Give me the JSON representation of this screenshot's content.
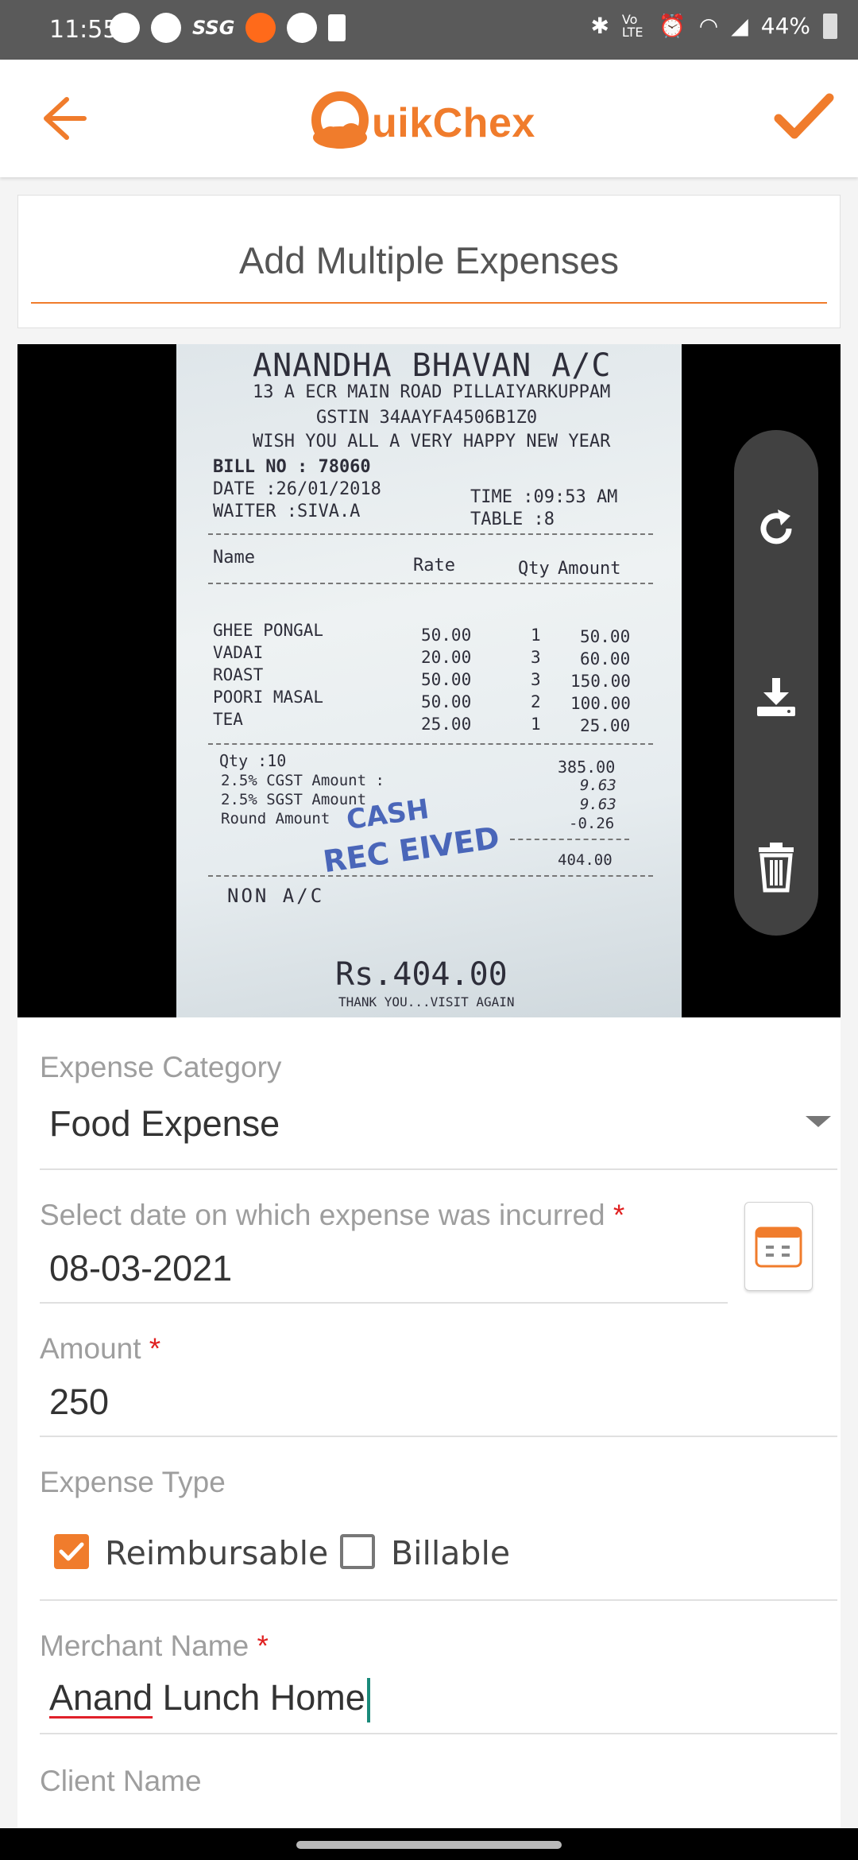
{
  "status_bar": {
    "time": "11:55",
    "battery": "44%",
    "carrier_label": "Vo LTE"
  },
  "app_bar": {
    "logo_text": "uikChex",
    "brand_color": "#f07c2c"
  },
  "page": {
    "title": "Add Multiple Expenses"
  },
  "receipt": {
    "restaurant": "ANANDHA BHAVAN A/C",
    "address": "13 A ECR MAIN ROAD PILLAIYARKUPPAM",
    "gstin": "GSTIN 34AAYFA4506B1Z0",
    "greeting": "WISH YOU ALL A VERY HAPPY NEW YEAR",
    "bill_no": "BILL NO  :  78060",
    "date": "DATE   :26/01/2018",
    "time": "TIME   :09:53 AM",
    "waiter": "WAITER :SIVA.A",
    "table": "TABLE  :8",
    "headers": [
      "Name",
      "Rate",
      "Qty",
      "Amount"
    ],
    "items": [
      {
        "name": "GHEE PONGAL",
        "rate": "50.00",
        "qty": "1",
        "amount": "50.00"
      },
      {
        "name": "VADAI",
        "rate": "20.00",
        "qty": "3",
        "amount": "60.00"
      },
      {
        "name": "ROAST",
        "rate": "50.00",
        "qty": "3",
        "amount": "150.00"
      },
      {
        "name": "POORI MASAL",
        "rate": "50.00",
        "qty": "2",
        "amount": "100.00"
      },
      {
        "name": "TEA",
        "rate": "25.00",
        "qty": "1",
        "amount": "25.00"
      }
    ],
    "qty_total": "Qty :10",
    "subtotal": "385.00",
    "cgst_label": "2.5% CGST Amount :",
    "cgst": "9.63",
    "sgst_label": "2.5% SGST Amount",
    "sgst": "9.63",
    "round_label": "Round Amount",
    "round": "-0.26",
    "total": "404.00",
    "non_ac": "NON A/C",
    "grand_total": "Rs.404.00",
    "footer": "THANK YOU...VISIT AGAIN",
    "stamp_line1": "CASH",
    "stamp_line2": "REC EIVED"
  },
  "form": {
    "expense_category": {
      "label": "Expense Category",
      "value": "Food Expense"
    },
    "date": {
      "label": "Select date on which expense was incurred",
      "required_mark": "*",
      "value": "08-03-2021"
    },
    "amount": {
      "label": "Amount",
      "required_mark": "*",
      "value": "250"
    },
    "expense_type": {
      "label": "Expense Type",
      "reimbursable": {
        "label": "Reimbursable",
        "checked": true
      },
      "billable": {
        "label": "Billable",
        "checked": false
      }
    },
    "merchant": {
      "label": "Merchant Name",
      "required_mark": "*",
      "value_misspelled": "Anand",
      "value_rest": " Lunch Home"
    },
    "client": {
      "label": "Client Name"
    }
  }
}
